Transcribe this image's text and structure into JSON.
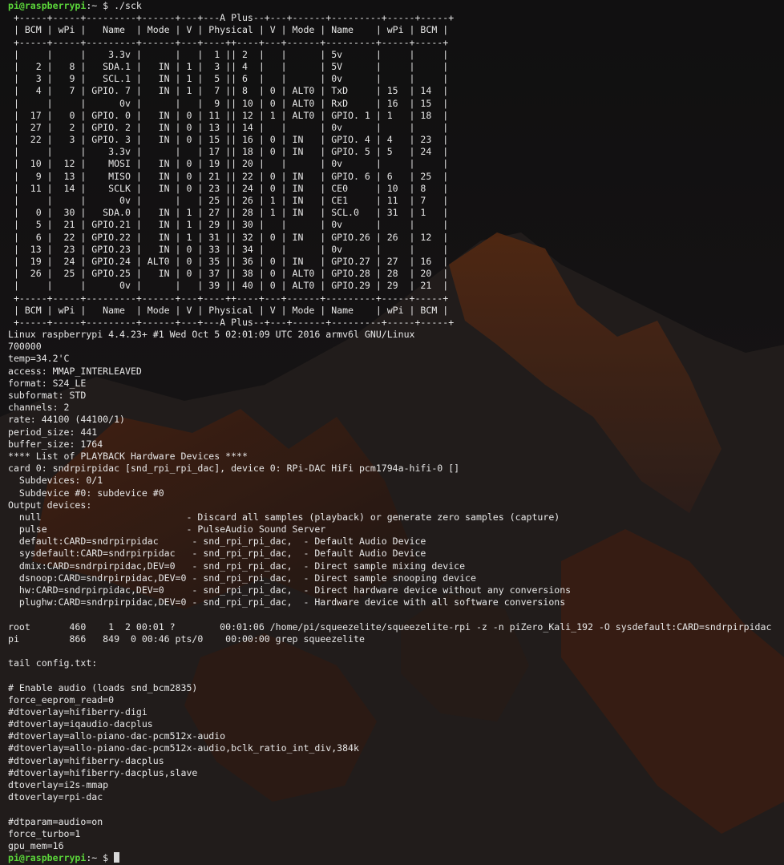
{
  "prompt": {
    "user_host": "pi@raspberrypi",
    "path_sep": ":~ $ "
  },
  "command": "./sck",
  "lines": [
    " +-----+-----+---------+------+---+---A Plus--+---+------+---------+-----+-----+",
    " | BCM | wPi |   Name  | Mode | V | Physical | V | Mode | Name    | wPi | BCM |",
    " +-----+-----+---------+------+---+----++----+---+------+---------+-----+-----+",
    " |     |     |    3.3v |      |   |  1 || 2  |   |      | 5v      |     |     |",
    " |   2 |   8 |   SDA.1 |   IN | 1 |  3 || 4  |   |      | 5V      |     |     |",
    " |   3 |   9 |   SCL.1 |   IN | 1 |  5 || 6  |   |      | 0v      |     |     |",
    " |   4 |   7 | GPIO. 7 |   IN | 1 |  7 || 8  | 0 | ALT0 | TxD     | 15  | 14  |",
    " |     |     |      0v |      |   |  9 || 10 | 0 | ALT0 | RxD     | 16  | 15  |",
    " |  17 |   0 | GPIO. 0 |   IN | 0 | 11 || 12 | 1 | ALT0 | GPIO. 1 | 1   | 18  |",
    " |  27 |   2 | GPIO. 2 |   IN | 0 | 13 || 14 |   |      | 0v      |     |     |",
    " |  22 |   3 | GPIO. 3 |   IN | 0 | 15 || 16 | 0 | IN   | GPIO. 4 | 4   | 23  |",
    " |     |     |    3.3v |      |   | 17 || 18 | 0 | IN   | GPIO. 5 | 5   | 24  |",
    " |  10 |  12 |    MOSI |   IN | 0 | 19 || 20 |   |      | 0v      |     |     |",
    " |   9 |  13 |    MISO |   IN | 0 | 21 || 22 | 0 | IN   | GPIO. 6 | 6   | 25  |",
    " |  11 |  14 |    SCLK |   IN | 0 | 23 || 24 | 0 | IN   | CE0     | 10  | 8   |",
    " |     |     |      0v |      |   | 25 || 26 | 1 | IN   | CE1     | 11  | 7   |",
    " |   0 |  30 |   SDA.0 |   IN | 1 | 27 || 28 | 1 | IN   | SCL.0   | 31  | 1   |",
    " |   5 |  21 | GPIO.21 |   IN | 1 | 29 || 30 |   |      | 0v      |     |     |",
    " |   6 |  22 | GPIO.22 |   IN | 1 | 31 || 32 | 0 | IN   | GPIO.26 | 26  | 12  |",
    " |  13 |  23 | GPIO.23 |   IN | 0 | 33 || 34 |   |      | 0v      |     |     |",
    " |  19 |  24 | GPIO.24 | ALT0 | 0 | 35 || 36 | 0 | IN   | GPIO.27 | 27  | 16  |",
    " |  26 |  25 | GPIO.25 |   IN | 0 | 37 || 38 | 0 | ALT0 | GPIO.28 | 28  | 20  |",
    " |     |     |      0v |      |   | 39 || 40 | 0 | ALT0 | GPIO.29 | 29  | 21  |",
    " +-----+-----+---------+------+---+----++----+---+------+---------+-----+-----+",
    " | BCM | wPi |   Name  | Mode | V | Physical | V | Mode | Name    | wPi | BCM |",
    " +-----+-----+---------+------+---+---A Plus--+---+------+---------+-----+-----+",
    "Linux raspberrypi 4.4.23+ #1 Wed Oct 5 02:01:09 UTC 2016 armv6l GNU/Linux",
    "700000",
    "temp=34.2'C",
    "access: MMAP_INTERLEAVED",
    "format: S24_LE",
    "subformat: STD",
    "channels: 2",
    "rate: 44100 (44100/1)",
    "period_size: 441",
    "buffer_size: 1764",
    "**** List of PLAYBACK Hardware Devices ****",
    "card 0: sndrpirpidac [snd_rpi_rpi_dac], device 0: RPi-DAC HiFi pcm1794a-hifi-0 []",
    "  Subdevices: 0/1",
    "  Subdevice #0: subdevice #0",
    "Output devices:",
    "  null                          - Discard all samples (playback) or generate zero samples (capture)",
    "  pulse                         - PulseAudio Sound Server",
    "  default:CARD=sndrpirpidac      - snd_rpi_rpi_dac,  - Default Audio Device",
    "  sysdefault:CARD=sndrpirpidac   - snd_rpi_rpi_dac,  - Default Audio Device",
    "  dmix:CARD=sndrpirpidac,DEV=0   - snd_rpi_rpi_dac,  - Direct sample mixing device",
    "  dsnoop:CARD=sndrpirpidac,DEV=0 - snd_rpi_rpi_dac,  - Direct sample snooping device",
    "  hw:CARD=sndrpirpidac,DEV=0     - snd_rpi_rpi_dac,  - Direct hardware device without any conversions",
    "  plughw:CARD=sndrpirpidac,DEV=0 - snd_rpi_rpi_dac,  - Hardware device with all software conversions",
    "",
    "root       460    1  2 00:01 ?        00:01:06 /home/pi/squeezelite/squeezelite-rpi -z -n piZero_Kali_192 -O sysdefault:CARD=sndrpirpidac",
    "pi         866   849  0 00:46 pts/0    00:00:00 grep squeezelite",
    "",
    "tail config.txt:",
    "",
    "# Enable audio (loads snd_bcm2835)",
    "force_eeprom_read=0",
    "#dtoverlay=hifiberry-digi",
    "#dtoverlay=iqaudio-dacplus",
    "#dtoverlay=allo-piano-dac-pcm512x-audio",
    "#dtoverlay=allo-piano-dac-pcm512x-audio,bclk_ratio_int_div,384k",
    "#dtoverlay=hifiberry-dacplus",
    "#dtoverlay=hifiberry-dacplus,slave",
    "dtoverlay=i2s-mmap",
    "dtoverlay=rpi-dac",
    "",
    "#dtparam=audio=on",
    "force_turbo=1",
    "gpu_mem=16"
  ]
}
